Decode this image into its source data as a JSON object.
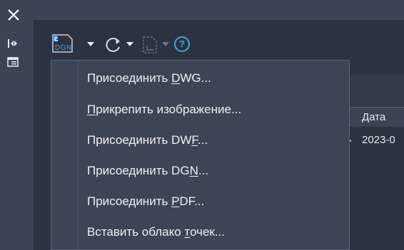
{
  "rail": {
    "close_icon": "close-icon",
    "collapse_icon": "collapse-panel-icon",
    "properties_icon": "properties-icon"
  },
  "toolbar": {
    "attach_button_label": "DGN",
    "attach_icon_badge": "C",
    "refresh_icon": "refresh-icon",
    "change_path_icon": "change-path-icon",
    "help_icon": "help-icon",
    "help_glyph": "?"
  },
  "table": {
    "column_header": "Дата",
    "first_cell": "2023-0"
  },
  "menu": {
    "items": [
      {
        "pre": "Присоединить ",
        "key": "D",
        "post": "WG..."
      },
      {
        "pre": "",
        "key": "П",
        "post": "рикрепить изображение..."
      },
      {
        "pre": "Присоединить DW",
        "key": "F",
        "post": "..."
      },
      {
        "pre": "Присоединить DG",
        "key": "N",
        "post": "..."
      },
      {
        "pre": "Присоединить ",
        "key": "P",
        "post": "DF..."
      },
      {
        "pre": "Вставить облако ",
        "key": "т",
        "post": "очек..."
      }
    ]
  },
  "colors": {
    "accent": "#3fa3e8",
    "panel": "#2b3240",
    "menu": "#3c4554"
  }
}
